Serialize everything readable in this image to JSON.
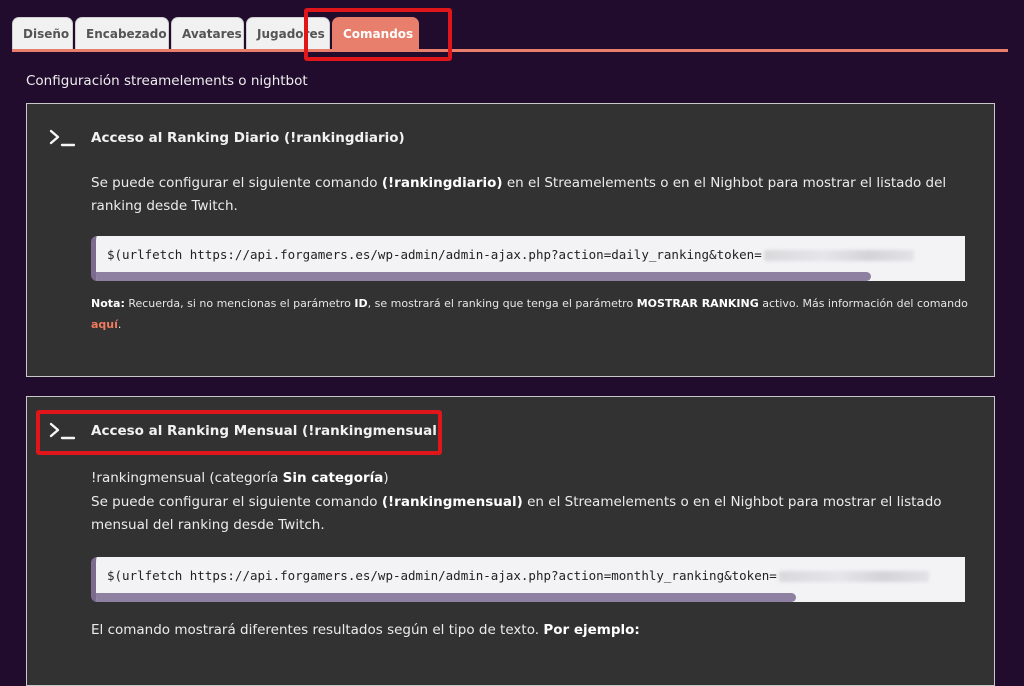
{
  "tabs": [
    {
      "label": "Diseño"
    },
    {
      "label": "Encabezado"
    },
    {
      "label": "Avatares"
    },
    {
      "label": "Jugadores"
    },
    {
      "label": "Comandos"
    }
  ],
  "intro": "Configuración streamelements o nightbot",
  "daily": {
    "title": "Acceso al Ranking Diario (!rankingdiario)",
    "desc_pre": "Se puede configurar el siguiente comando ",
    "desc_cmd": "(!rankingdiario)",
    "desc_post": " en el Streamelements o en el Nighbot para mostrar el listado del ranking desde Twitch.",
    "code": "$(urlfetch https://api.forgamers.es/wp-admin/admin-ajax.php?action=daily_ranking&token=",
    "note_label": "Nota:",
    "note_1": " Recuerda, si no mencionas el parámetro ",
    "note_id": "ID",
    "note_2": ", se mostrará el ranking que tenga el parámetro ",
    "note_param": "MOSTRAR RANKING",
    "note_3": " activo. Más información del comando ",
    "note_link": "aquí",
    "note_end": "."
  },
  "monthly": {
    "title": "Acceso al Ranking Mensual (!rankingmensual)",
    "cat_pre": "!rankingmensual (categoría ",
    "cat_name": "Sin categoría",
    "cat_post": ")",
    "desc_pre": "Se puede configurar el siguiente comando ",
    "desc_cmd": "(!rankingmensual)",
    "desc_post": " en el Streamelements o en el Nighbot para mostrar el listado mensual del ranking desde Twitch.",
    "code": "$(urlfetch https://api.forgamers.es/wp-admin/admin-ajax.php?action=monthly_ranking&token=",
    "result_text": "El comando mostrará diferentes resultados según el tipo de texto. ",
    "result_bold": "Por ejemplo:"
  },
  "colors": {
    "background": "#220c2e",
    "accent": "#e77f6c",
    "panel": "#323232",
    "highlight": "#e0161a",
    "link": "#f07a5e"
  }
}
